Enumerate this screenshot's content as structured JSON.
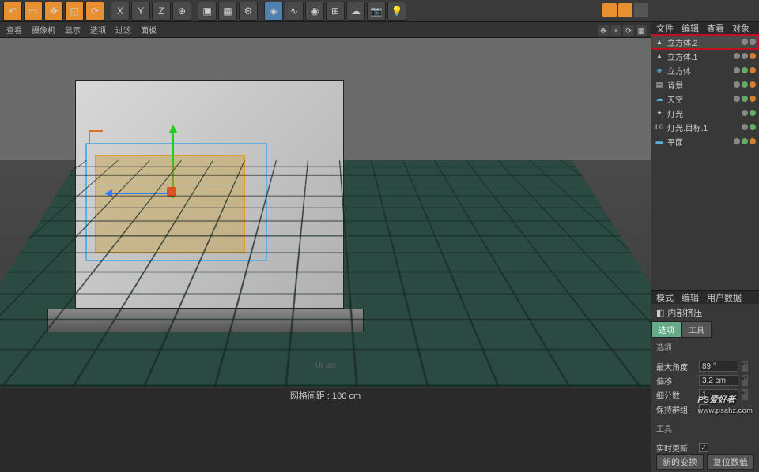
{
  "toolbar": {
    "axis_x": "X",
    "axis_y": "Y",
    "axis_z": "Z"
  },
  "subbar": {
    "view": "查看",
    "camera": "摄像机",
    "display": "显示",
    "options": "选项",
    "filter": "过滤",
    "panel": "面板"
  },
  "objects": {
    "header": {
      "file": "文件",
      "edit": "编辑",
      "view": "查看",
      "obj": "对象"
    },
    "items": [
      {
        "label": "立方体.2"
      },
      {
        "label": "立方体.1"
      },
      {
        "label": "立方体"
      },
      {
        "label": "背景"
      },
      {
        "label": "天空"
      },
      {
        "label": "灯光"
      },
      {
        "label": "灯光.目标.1"
      },
      {
        "label": "平面"
      }
    ]
  },
  "attributes": {
    "header": {
      "mode": "模式",
      "edit": "编辑",
      "userdata": "用户数据"
    },
    "title": "内部挤压",
    "tabs": {
      "options": "选项",
      "tools": "工具"
    },
    "section_options": "选项",
    "max_angle_label": "最大角度",
    "max_angle_value": "89 °",
    "offset_label": "偏移",
    "offset_value": "3.2 cm",
    "subdiv_label": "细分数",
    "subdiv_value": "1",
    "keep_group_label": "保持群组",
    "section_tools": "工具",
    "realtime_label": "实时更新",
    "btn_new": "新的变换",
    "btn_reset": "复位数值"
  },
  "status": {
    "grid_distance": "网格间距 : 100 cm",
    "logo": "Ui .cn"
  },
  "watermark": {
    "main": "PS爱好者",
    "sub": "www.psahz.com"
  }
}
